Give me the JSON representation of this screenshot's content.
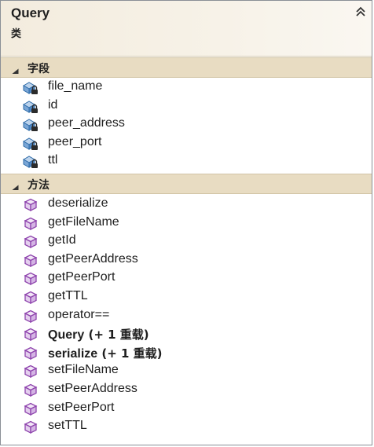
{
  "class": {
    "name": "Query",
    "kind": "类"
  },
  "colors": {
    "header_bg": "#f3ecde",
    "section_bg": "#e8dcc2",
    "method_icon": "#9b59b6",
    "field_icon": "#3a78b8"
  },
  "fields": {
    "label": "字段",
    "items": [
      "file_name",
      "id",
      "peer_address",
      "peer_port",
      "ttl"
    ]
  },
  "methods": {
    "label": "方法",
    "items": [
      {
        "name": "deserialize",
        "bold": false,
        "overload": ""
      },
      {
        "name": "getFileName",
        "bold": false,
        "overload": ""
      },
      {
        "name": "getId",
        "bold": false,
        "overload": ""
      },
      {
        "name": "getPeerAddress",
        "bold": false,
        "overload": ""
      },
      {
        "name": "getPeerPort",
        "bold": false,
        "overload": ""
      },
      {
        "name": "getTTL",
        "bold": false,
        "overload": ""
      },
      {
        "name": "operator==",
        "bold": false,
        "overload": ""
      },
      {
        "name": "Query",
        "bold": true,
        "overload": "(+ 1 重载)"
      },
      {
        "name": "serialize",
        "bold": true,
        "overload": "(+ 1 重载)"
      },
      {
        "name": "setFileName",
        "bold": false,
        "overload": ""
      },
      {
        "name": "setPeerAddress",
        "bold": false,
        "overload": ""
      },
      {
        "name": "setPeerPort",
        "bold": false,
        "overload": ""
      },
      {
        "name": "setTTL",
        "bold": false,
        "overload": ""
      }
    ]
  },
  "icons": {
    "collapse": "double-chevron-up-icon",
    "section_toggle": "triangle-expanded-icon",
    "field": "private-field-icon",
    "method": "method-cube-icon"
  }
}
